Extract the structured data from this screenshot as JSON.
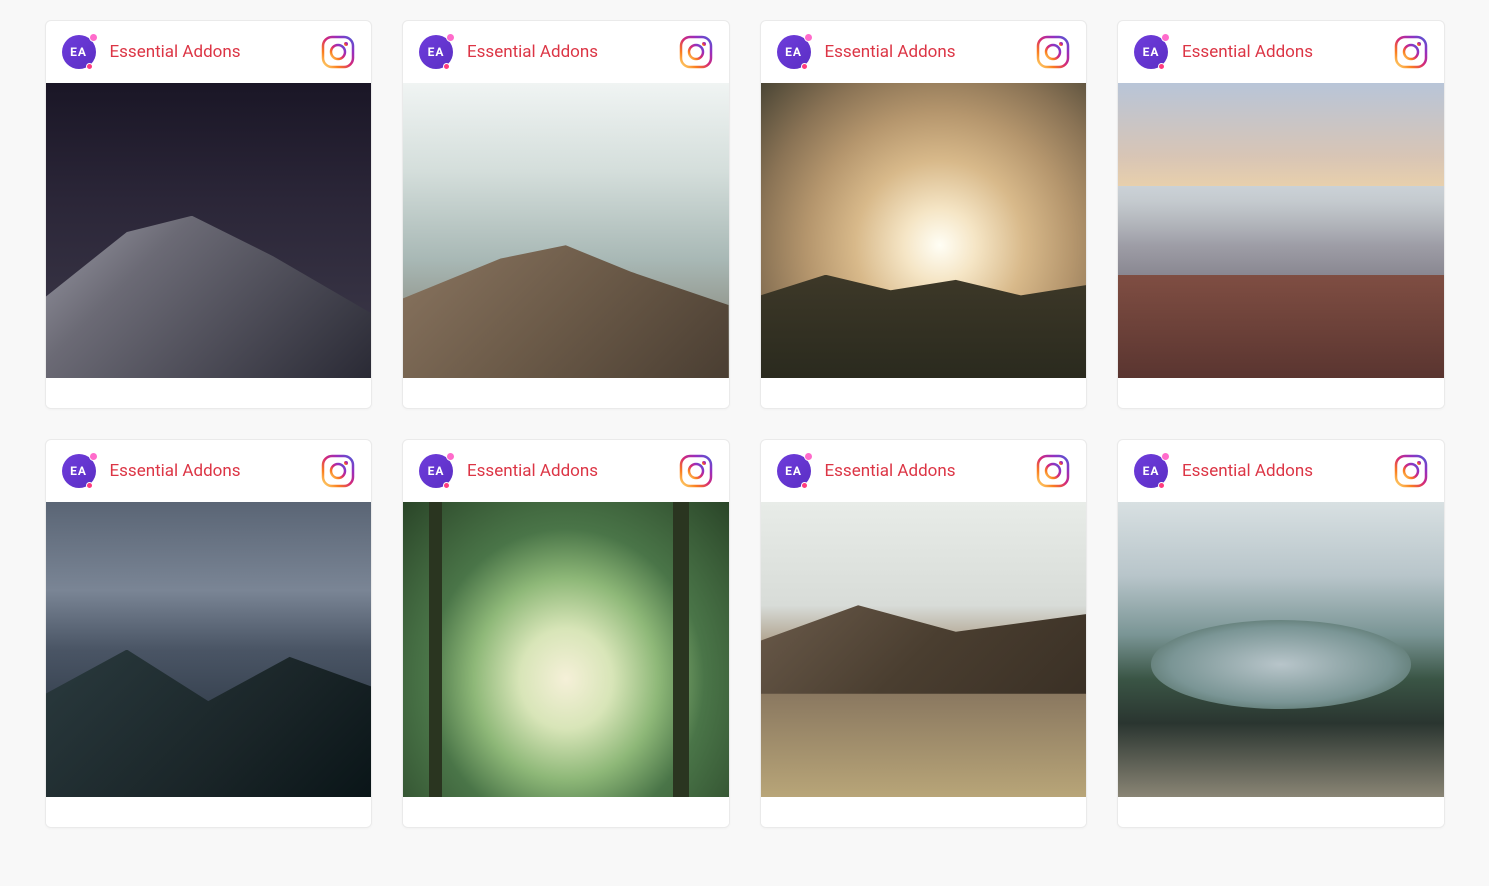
{
  "cards": [
    {
      "title": "Essential Addons",
      "avatar_label": "EA",
      "image_class": "img1"
    },
    {
      "title": "Essential Addons",
      "avatar_label": "EA",
      "image_class": "img2"
    },
    {
      "title": "Essential Addons",
      "avatar_label": "EA",
      "image_class": "img3"
    },
    {
      "title": "Essential Addons",
      "avatar_label": "EA",
      "image_class": "img4"
    },
    {
      "title": "Essential Addons",
      "avatar_label": "EA",
      "image_class": "img5"
    },
    {
      "title": "Essential Addons",
      "avatar_label": "EA",
      "image_class": "img6"
    },
    {
      "title": "Essential Addons",
      "avatar_label": "EA",
      "image_class": "img7"
    },
    {
      "title": "Essential Addons",
      "avatar_label": "EA",
      "image_class": "img8"
    }
  ]
}
